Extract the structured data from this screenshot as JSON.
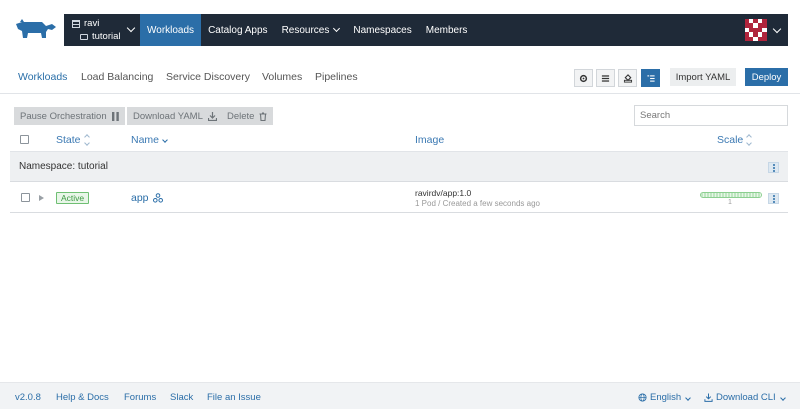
{
  "header": {
    "cluster": "ravi",
    "project": "tutorial",
    "nav": [
      {
        "label": "Workloads",
        "active": true,
        "dropdown": false
      },
      {
        "label": "Catalog Apps",
        "active": false,
        "dropdown": false
      },
      {
        "label": "Resources",
        "active": false,
        "dropdown": true
      },
      {
        "label": "Namespaces",
        "active": false,
        "dropdown": false
      },
      {
        "label": "Members",
        "active": false,
        "dropdown": false
      }
    ]
  },
  "subnav": {
    "tabs": [
      {
        "label": "Workloads",
        "active": true
      },
      {
        "label": "Load Balancing",
        "active": false
      },
      {
        "label": "Service Discovery",
        "active": false
      },
      {
        "label": "Volumes",
        "active": false
      },
      {
        "label": "Pipelines",
        "active": false
      }
    ],
    "view_buttons": [
      "gear-icon",
      "list-icon",
      "cluster-icon",
      "group-icon"
    ],
    "import_label": "Import YAML",
    "deploy_label": "Deploy"
  },
  "bulk_actions": {
    "pause": "Pause Orchestration",
    "download": "Download YAML",
    "delete": "Delete"
  },
  "search": {
    "placeholder": "Search"
  },
  "table": {
    "columns": {
      "state": "State",
      "name": "Name",
      "image": "Image",
      "scale": "Scale"
    },
    "namespace_label": "Namespace: tutorial",
    "rows": [
      {
        "state": "Active",
        "name": "app",
        "image": "ravirdv/app:1.0",
        "detail": "1 Pod / Created a few seconds ago",
        "scale": "1"
      }
    ]
  },
  "footer": {
    "version": "v2.0.8",
    "help": "Help & Docs",
    "forums": "Forums",
    "slack": "Slack",
    "issue": "File an Issue",
    "language": "English",
    "download_cli": "Download CLI"
  },
  "colors": {
    "navbar": "#1f2a38",
    "accent": "#2b6ea8",
    "active_badge": "#3c9a42"
  }
}
